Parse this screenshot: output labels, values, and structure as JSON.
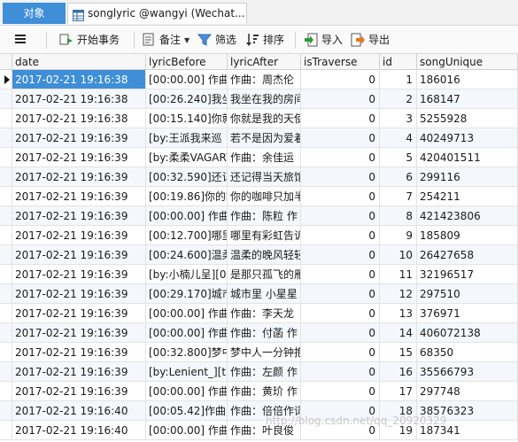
{
  "tabs": {
    "objects_label": "对象",
    "table_tab_label": "songlyric @wangyi (Wechat..."
  },
  "toolbar": {
    "begin_transaction": "开始事务",
    "note": "备注",
    "filter": "筛选",
    "sort": "排序",
    "import": "导入",
    "export": "导出"
  },
  "grid": {
    "columns": [
      "date",
      "lyricBefore",
      "lyricAfter",
      "isTraverse",
      "id",
      "songUnique"
    ],
    "rows": [
      {
        "date": "2017-02-21 19:16:38",
        "lyricBefore": "[00:00.00] 作曲：",
        "lyricAfter": "作曲：周杰伦",
        "isTraverse": "0",
        "id": "1",
        "songUnique": "186016"
      },
      {
        "date": "2017-02-21 19:16:38",
        "lyricBefore": "[00:26.240]我坐在",
        "lyricAfter": "我坐在我的房间",
        "isTraverse": "0",
        "id": "2",
        "songUnique": "168147"
      },
      {
        "date": "2017-02-21 19:16:38",
        "lyricBefore": "[00:15.140]你就是",
        "lyricAfter": "你就是我的天使",
        "isTraverse": "0",
        "id": "3",
        "songUnique": "5255928"
      },
      {
        "date": "2017-02-21 19:16:39",
        "lyricBefore": "[by:王派我来巡",
        "lyricAfter": "若不是因为爱着",
        "isTraverse": "0",
        "id": "4",
        "songUnique": "40249713"
      },
      {
        "date": "2017-02-21 19:16:39",
        "lyricBefore": "[by:柔柔VAGARY",
        "lyricAfter": "作曲：余佳运",
        "isTraverse": "0",
        "id": "5",
        "songUnique": "420401511"
      },
      {
        "date": "2017-02-21 19:16:39",
        "lyricBefore": "[00:32.590]还记得",
        "lyricAfter": "还记得当天旅馆",
        "isTraverse": "0",
        "id": "6",
        "songUnique": "299116"
      },
      {
        "date": "2017-02-21 19:16:39",
        "lyricBefore": "[00:19.86]你的咖",
        "lyricAfter": "你的咖啡只加半",
        "isTraverse": "0",
        "id": "7",
        "songUnique": "254211"
      },
      {
        "date": "2017-02-21 19:16:39",
        "lyricBefore": "[00:00.00] 作曲：",
        "lyricAfter": "作曲：陈粒 作",
        "isTraverse": "0",
        "id": "8",
        "songUnique": "421423806"
      },
      {
        "date": "2017-02-21 19:16:39",
        "lyricBefore": "[00:12.700]哪里有",
        "lyricAfter": "哪里有彩虹告诉",
        "isTraverse": "0",
        "id": "9",
        "songUnique": "185809"
      },
      {
        "date": "2017-02-21 19:16:39",
        "lyricBefore": "[00:24.600]温柔的",
        "lyricAfter": "温柔的晚风轻轻",
        "isTraverse": "0",
        "id": "10",
        "songUnique": "26427658"
      },
      {
        "date": "2017-02-21 19:16:39",
        "lyricBefore": "[by:小楠儿呈][00",
        "lyricAfter": "是那只孤飞的雁",
        "isTraverse": "0",
        "id": "11",
        "songUnique": "32196517"
      },
      {
        "date": "2017-02-21 19:16:39",
        "lyricBefore": "[00:29.170]城市里",
        "lyricAfter": "城市里 小星星",
        "isTraverse": "0",
        "id": "12",
        "songUnique": "297510"
      },
      {
        "date": "2017-02-21 19:16:39",
        "lyricBefore": "[00:00.00] 作曲：",
        "lyricAfter": "作曲：李天龙",
        "isTraverse": "0",
        "id": "13",
        "songUnique": "376971"
      },
      {
        "date": "2017-02-21 19:16:39",
        "lyricBefore": "[00:00.00] 作曲：",
        "lyricAfter": "作曲：付菡 作",
        "isTraverse": "0",
        "id": "14",
        "songUnique": "406072138"
      },
      {
        "date": "2017-02-21 19:16:39",
        "lyricBefore": "[00:32.800]梦中人",
        "lyricAfter": "梦中人一分钟抱",
        "isTraverse": "0",
        "id": "15",
        "songUnique": "68350"
      },
      {
        "date": "2017-02-21 19:16:39",
        "lyricBefore": "[by:Lenient_][ti:C",
        "lyricAfter": "作曲：左颜 作",
        "isTraverse": "0",
        "id": "16",
        "songUnique": "35566793"
      },
      {
        "date": "2017-02-21 19:16:39",
        "lyricBefore": "[00:00.00] 作曲：",
        "lyricAfter": "作曲：黄玠 作",
        "isTraverse": "0",
        "id": "17",
        "songUnique": "297748"
      },
      {
        "date": "2017-02-21 19:16:40",
        "lyricBefore": "[00:05.42]作曲：",
        "lyricAfter": "作曲：倍倍作词",
        "isTraverse": "0",
        "id": "18",
        "songUnique": "38576323"
      },
      {
        "date": "2017-02-21 19:16:40",
        "lyricBefore": "[00:00.00] 作曲：",
        "lyricAfter": "作曲：叶良俊",
        "isTraverse": "0",
        "id": "19",
        "songUnique": "187341"
      }
    ]
  },
  "watermark": "http://blog.csdn.net/qq_20920329"
}
